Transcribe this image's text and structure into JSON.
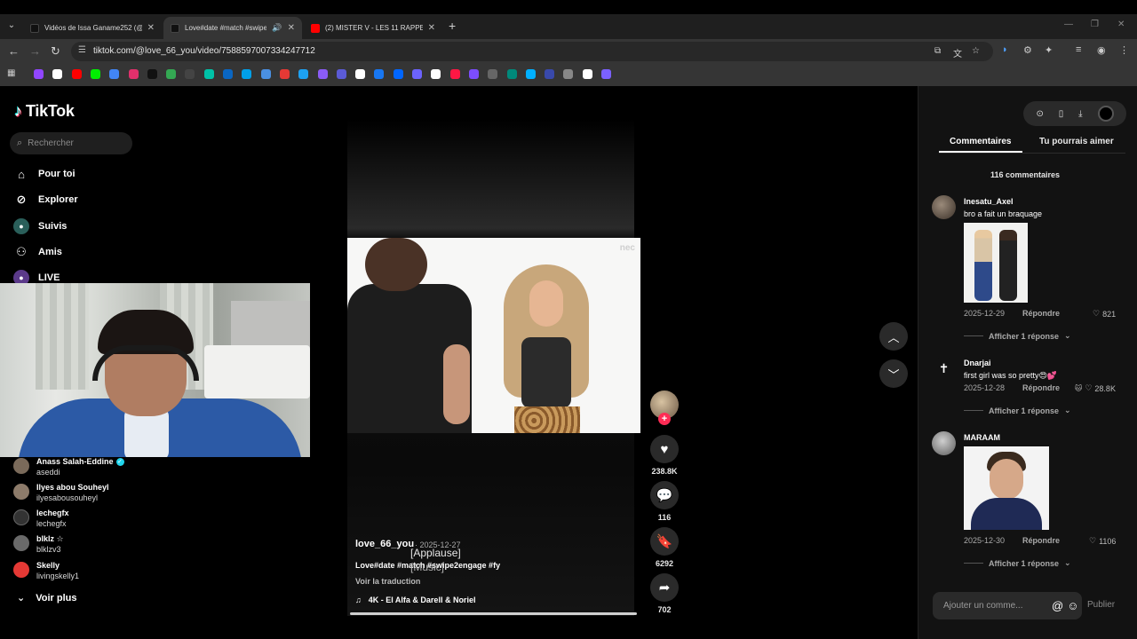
{
  "browser": {
    "tabs": [
      {
        "title": "Vidéos de Issa Ganame252 (@is",
        "favicon_color": "#111111",
        "active": false
      },
      {
        "title": "Love#date #match #swipe2",
        "favicon_color": "#111111",
        "active": true
      },
      {
        "title": "(2) MISTER V - LES 11 RAPPEUR",
        "favicon_color": "#ff0000",
        "active": false
      }
    ],
    "url": "tiktok.com/@love_66_you/video/7588597007334247712",
    "bookmark_colors": [
      "#9146ff",
      "#ffffff",
      "#ff0000",
      "#0e0",
      "#4285f4",
      "#e1306c",
      "#111111",
      "#34a853",
      "#444",
      "#00c2a8",
      "#0a66c2",
      "#00a0e9",
      "#4a90e2",
      "#e53935",
      "#1da1f2",
      "#8b5cf6",
      "#5b5bd6",
      "#ffffff",
      "#1877f2",
      "#0066ff",
      "#6c63ff",
      "#ffffff",
      "#ff1744",
      "#7c4dff",
      "#666",
      "#00897b",
      "#00b0ff",
      "#3949ab",
      "#888",
      "#ffffff",
      "#7b61ff"
    ]
  },
  "sidebar": {
    "logo": "TikTok",
    "search_placeholder": "Rechercher",
    "nav": [
      {
        "label": "Pour toi",
        "icon": "home-icon"
      },
      {
        "label": "Explorer",
        "icon": "compass-icon"
      },
      {
        "label": "Suivis",
        "icon": "following-icon"
      },
      {
        "label": "Amis",
        "icon": "friends-icon"
      },
      {
        "label": "LIVE",
        "icon": "live-icon"
      }
    ],
    "following": [
      {
        "name": "Anass Salah-Eddine",
        "handle": "aseddi",
        "verified": true,
        "color": "#7a6a5a"
      },
      {
        "name": "Ilyes abou Souheyl",
        "handle": "ilyesabousouheyl",
        "verified": false,
        "color": "#8d7b6a"
      },
      {
        "name": "lechegfx",
        "handle": "lechegfx",
        "verified": false,
        "color": "#333333"
      },
      {
        "name": "blklz ☆",
        "handle": "blklzv3",
        "verified": false,
        "color": "#6a6a6a"
      },
      {
        "name": "Skelly",
        "handle": "livingskelly1",
        "verified": false,
        "color": "#e53935"
      }
    ],
    "voir_plus": "Voir plus"
  },
  "video": {
    "brand": "nec",
    "username": "love_66_you",
    "date": "· 2025-12-27",
    "caption": "Love#date #match #swipe2engage #fy",
    "subtitle_1": "[Applause]",
    "subtitle_2": "[Music]",
    "translate": "Voir la traduction",
    "music": "4K - El Alfa & Darell & Noriel",
    "progress": 1.0
  },
  "actions": {
    "likes": "238.8K",
    "comments": "116",
    "saves": "6292",
    "shares": "702"
  },
  "panel": {
    "tab_comments": "Commentaires",
    "tab_suggested": "Tu pourrais aimer",
    "count": "116 commentaires",
    "reply": "Répondre",
    "show_replies": "Afficher 1 réponse",
    "comments": [
      {
        "name": "Inesatu_Axel",
        "text": "bro a fait un braquage",
        "date": "2025-12-29",
        "likes": "821"
      },
      {
        "name": "Dnarjai",
        "text": "first girl was so pretty😍💕",
        "date": "2025-12-28",
        "likes": "28.8K"
      },
      {
        "name": "MARAAM",
        "text": "",
        "date": "2025-12-30",
        "likes": "1106"
      }
    ],
    "input_placeholder": "Ajouter un comme...",
    "publish": "Publier"
  }
}
